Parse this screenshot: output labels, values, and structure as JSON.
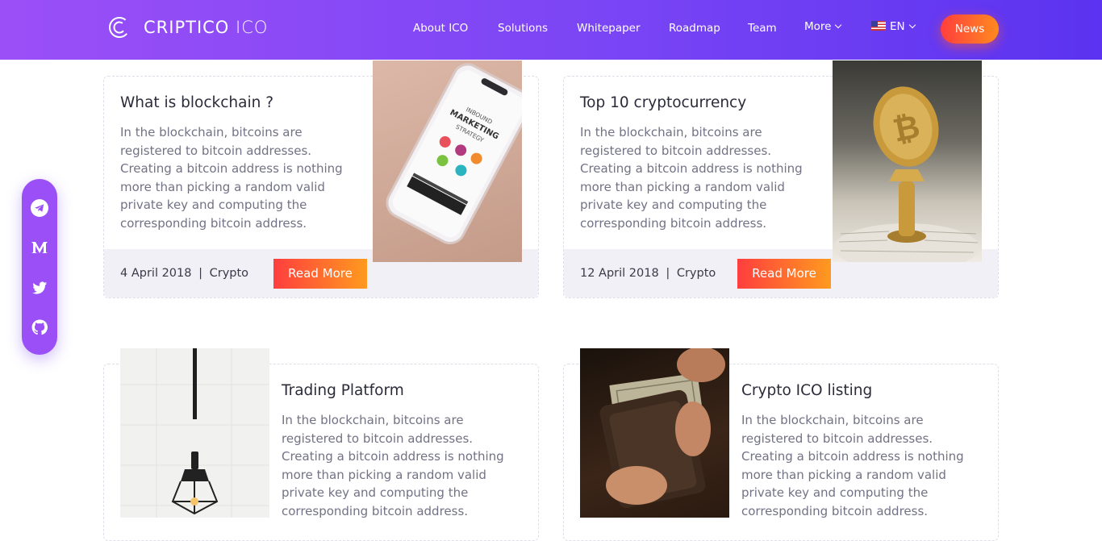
{
  "brand": {
    "name_bold": "CRIPTICO",
    "name_light": "ICO"
  },
  "nav": {
    "about": "About ICO",
    "solutions": "Solutions",
    "whitepaper": "Whitepaper",
    "roadmap": "Roadmap",
    "team": "Team",
    "more": "More",
    "language": "EN",
    "news": "News"
  },
  "social": [
    "telegram-icon",
    "medium-icon",
    "twitter-icon",
    "github-icon"
  ],
  "posts": [
    {
      "title": "What is blockchain ?",
      "excerpt": "In the blockchain, bitcoins are registered to bitcoin addresses. Creating a bitcoin address is nothing more than picking a random valid private key and computing the corresponding bitcoin address.",
      "date": "4 April 2018",
      "separator": "|",
      "category": "Crypto",
      "button": "Read More"
    },
    {
      "title": "Top 10 cryptocurrency",
      "excerpt": "In the blockchain, bitcoins are registered to bitcoin addresses. Creating a bitcoin address is nothing more than picking a random valid private key and computing the corresponding bitcoin address.",
      "date": "12 April 2018",
      "separator": "|",
      "category": "Crypto",
      "button": "Read More"
    },
    {
      "title": "Trading Platform",
      "excerpt": "In the blockchain, bitcoins are registered to bitcoin addresses. Creating a bitcoin address is nothing more than picking a random valid private key and computing the corresponding bitcoin address."
    },
    {
      "title": "Crypto ICO listing",
      "excerpt": "In the blockchain, bitcoins are registered to bitcoin addresses. Creating a bitcoin address is nothing more than picking a random valid private key and computing the corresponding bitcoin address."
    }
  ],
  "phone_screen": {
    "line1": "INBOUND",
    "line2": "MARKETING",
    "line3": "STRATEGY"
  },
  "colors": {
    "header_start": "#9b4ff7",
    "header_end": "#5b33f0",
    "accent_start": "#ff3e3e",
    "accent_end": "#ff9a1f"
  }
}
